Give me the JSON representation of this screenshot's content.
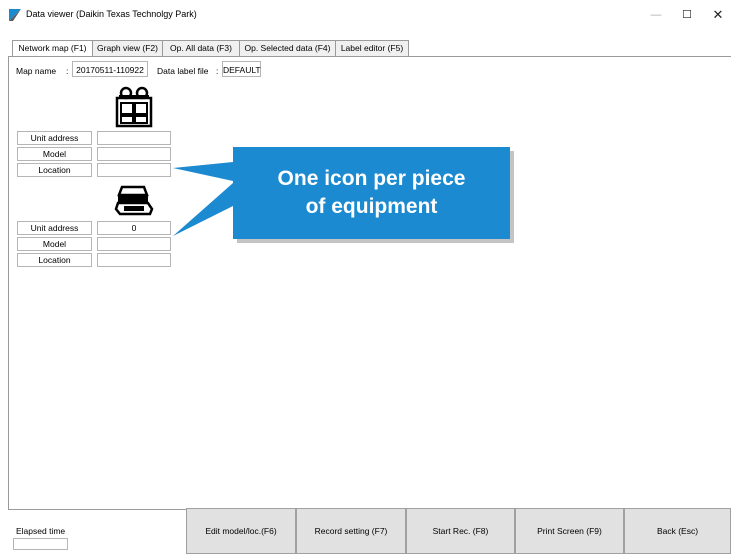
{
  "window": {
    "title": "Data viewer (Daikin Texas Technolgy Park)",
    "minimize": "—",
    "maximize": "☐",
    "close": "✕"
  },
  "tabs": [
    {
      "label": "Network map (F1)",
      "active": true
    },
    {
      "label": "Graph view (F2)",
      "active": false
    },
    {
      "label": "Op. All data (F3)",
      "active": false
    },
    {
      "label": "Op. Selected data (F4)",
      "active": false
    },
    {
      "label": "Label editor (F5)",
      "active": false
    }
  ],
  "map": {
    "map_name_label": "Map name",
    "colon": ":",
    "map_name_value": "20170511-110922",
    "data_label_file_label": "Data label file",
    "data_label_file_value": "DEFAULT"
  },
  "units": [
    {
      "icon": "outdoor-unit-icon",
      "rows": [
        {
          "label": "Unit address",
          "value": ""
        },
        {
          "label": "Model",
          "value": ""
        },
        {
          "label": "Location",
          "value": ""
        }
      ]
    },
    {
      "icon": "cassette-unit-icon",
      "rows": [
        {
          "label": "Unit address",
          "value": "0"
        },
        {
          "label": "Model",
          "value": ""
        },
        {
          "label": "Location",
          "value": ""
        }
      ]
    }
  ],
  "callout": {
    "line1": "One icon per piece",
    "line2": "of equipment",
    "color": "#1b8ad1"
  },
  "footer": {
    "elapsed_label": "Elapsed time",
    "elapsed_value": "",
    "buttons": [
      {
        "label": "Edit model/loc.(F6)"
      },
      {
        "label": "Record setting (F7)"
      },
      {
        "label": "Start Rec. (F8)"
      },
      {
        "label": "Print Screen (F9)"
      },
      {
        "label": "Back (Esc)"
      }
    ]
  }
}
